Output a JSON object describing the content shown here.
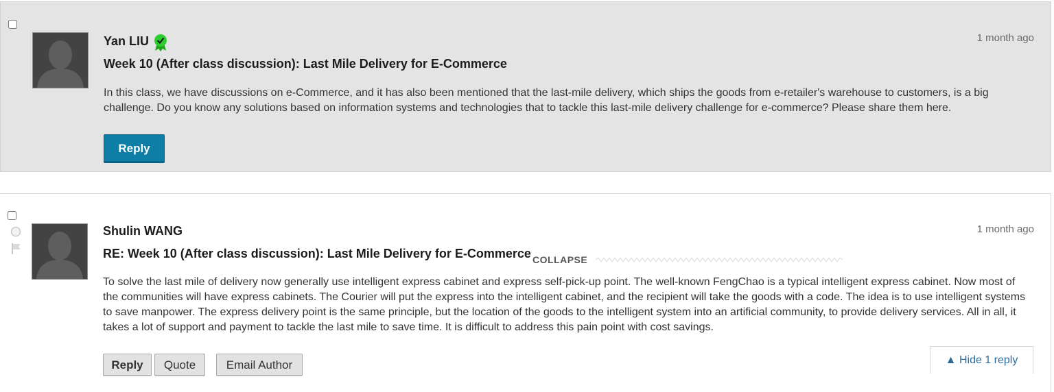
{
  "posts": [
    {
      "author": "Yan LIU",
      "badge_icon": "verified-ribbon-icon",
      "time": "1 month ago",
      "title": "Week 10 (After class discussion): Last Mile Delivery for E-Commerce",
      "body": "In this class, we have discussions on e-Commerce, and it has also been mentioned that the last-mile delivery, which ships the goods from e-retailer's warehouse to customers, is a big challenge. Do you know any solutions based on information systems and technologies that to tackle this last-mile delivery challenge for e-commerce? Please share them here.",
      "reply_label": "Reply"
    },
    {
      "author": "Shulin WANG",
      "time": "1 month ago",
      "title": "RE: Week 10 (After class discussion): Last Mile Delivery for E-Commerce",
      "collapse_label": "COLLAPSE",
      "body": "To solve the last mile of delivery now generally use intelligent express cabinet and express self-pick-up point. The well-known FengChao is a typical intelligent express cabinet. Now most of the communities will have express cabinets. The Courier will put the express into the intelligent cabinet, and the recipient will take the goods with a code. The idea is to use intelligent systems to save manpower. The express delivery point is the same principle, but the location of the goods to the intelligent system into an artificial community, to provide delivery services. All in all, it takes a lot of support and payment to tackle the last mile to save time. It is difficult to address this pain point with cost savings.",
      "buttons": {
        "reply": "Reply",
        "quote": "Quote",
        "email": "Email Author"
      },
      "hide_replies": "▲ Hide 1 reply"
    }
  ],
  "colors": {
    "primary_button": "#0e7ea7",
    "badge": "#2ecc2e",
    "link": "#2a6b9c"
  }
}
